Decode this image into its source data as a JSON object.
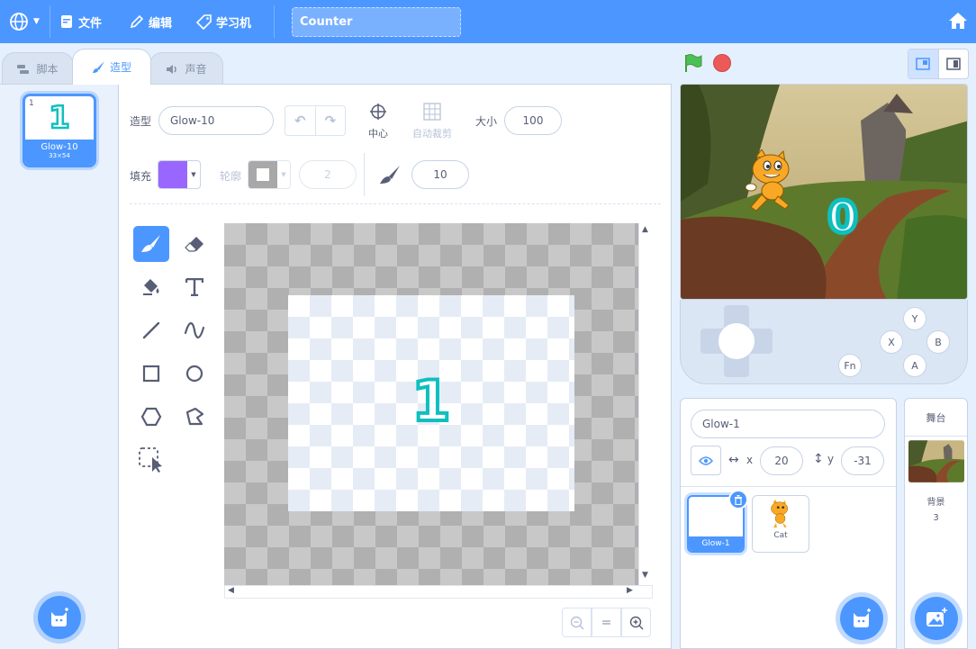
{
  "menu": {
    "file": "文件",
    "edit": "编辑",
    "learn": "学习机",
    "project_title": "Counter"
  },
  "tabs": {
    "code": "脚本",
    "costumes": "造型",
    "sounds": "声音"
  },
  "costume_list": [
    {
      "index": "1",
      "name": "Glow-10",
      "size": "33×54",
      "glyph": "1"
    }
  ],
  "paint": {
    "costume_label": "造型",
    "costume_name": "Glow-10",
    "center_label": "中心",
    "autocrop_label": "自动裁剪",
    "size_label": "大小",
    "size_value": "100",
    "fill_label": "填充",
    "fill_color": "#9966ff",
    "outline_label": "轮廓",
    "outline_width": "2",
    "brush_size": "10",
    "canvas_glyph": "1",
    "glyph_color": "#0fbfbf"
  },
  "tools": [
    "brush-icon",
    "eraser-icon",
    "fill-icon",
    "text-icon",
    "line-icon",
    "curve-icon",
    "rectangle-icon",
    "circle-icon",
    "polygon-icon",
    "reshape-icon",
    "select-icon"
  ],
  "zoom": {
    "minus": "−",
    "reset": "=",
    "plus": "+"
  },
  "stage": {
    "counter_display": "0"
  },
  "gamepad": {
    "y": "Y",
    "x": "X",
    "b": "B",
    "a": "A",
    "fn": "Fn"
  },
  "sprite_info": {
    "name": "Glow-1",
    "x_label": "x",
    "x_value": "20",
    "y_label": "y",
    "y_value": "-31"
  },
  "sprites": [
    {
      "name": "Glow-1",
      "selected": true
    },
    {
      "name": "Cat",
      "selected": false
    }
  ],
  "stage_panel": {
    "title": "舞台",
    "backdrops_label": "背景",
    "backdrop_count": "3"
  },
  "colors": {
    "accent": "#4c97ff",
    "bg": "#e5f0ff"
  }
}
